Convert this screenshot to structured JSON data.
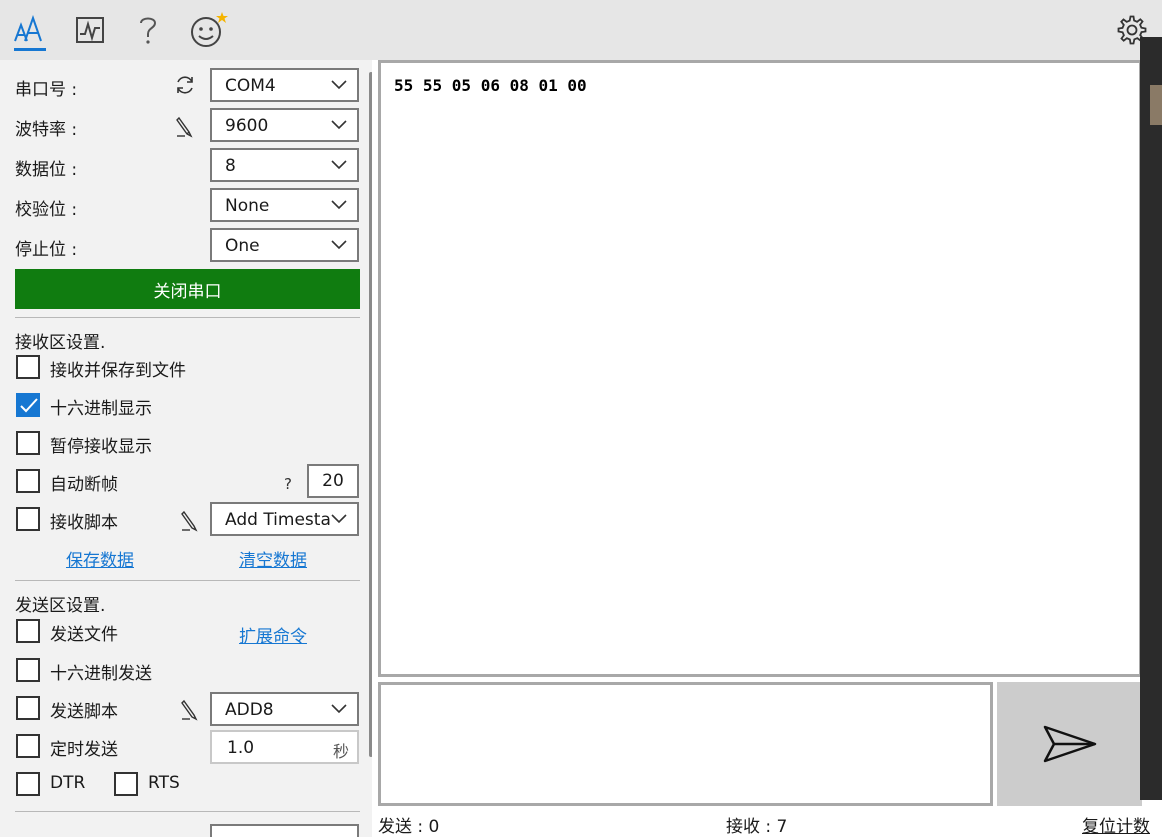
{
  "toolbar": {
    "tabs": [
      "font-icon",
      "chart-icon",
      "help-icon",
      "smiley-icon"
    ],
    "settings": "gear-icon"
  },
  "serial": {
    "port_label": "串口号 :",
    "port_value": "COM4",
    "baud_label": "波特率 :",
    "baud_value": "9600",
    "databits_label": "数据位 :",
    "databits_value": "8",
    "parity_label": "校验位 :",
    "parity_value": "None",
    "stopbits_label": "停止位 :",
    "stopbits_value": "One",
    "toggle_button": "关闭串口"
  },
  "receive": {
    "section_title": "接收区设置.",
    "save_to_file": "接收并保存到文件",
    "hex_display": "十六进制显示",
    "pause_display": "暂停接收显示",
    "auto_frame": "自动断帧",
    "auto_frame_help": "?",
    "auto_frame_value": "20",
    "script": "接收脚本",
    "script_value": "Add Timestamp",
    "save_data": "保存数据",
    "clear_data": "清空数据"
  },
  "send": {
    "section_title": "发送区设置.",
    "send_file": "发送文件",
    "extend_cmd": "扩展命令",
    "hex_send": "十六进制发送",
    "script": "发送脚本",
    "script_value": "ADD8",
    "timed_send": "定时发送",
    "interval_value": "1.0",
    "interval_unit": "秒",
    "dtr": "DTR",
    "rts": "RTS"
  },
  "recv_area": {
    "content": "55 55 05 06 08 01 00"
  },
  "status": {
    "sent": "发送 : 0",
    "received": "接收 : 7",
    "reset": "复位计数"
  },
  "colors": {
    "accent": "#1677d2",
    "open_button": "#107c10"
  }
}
